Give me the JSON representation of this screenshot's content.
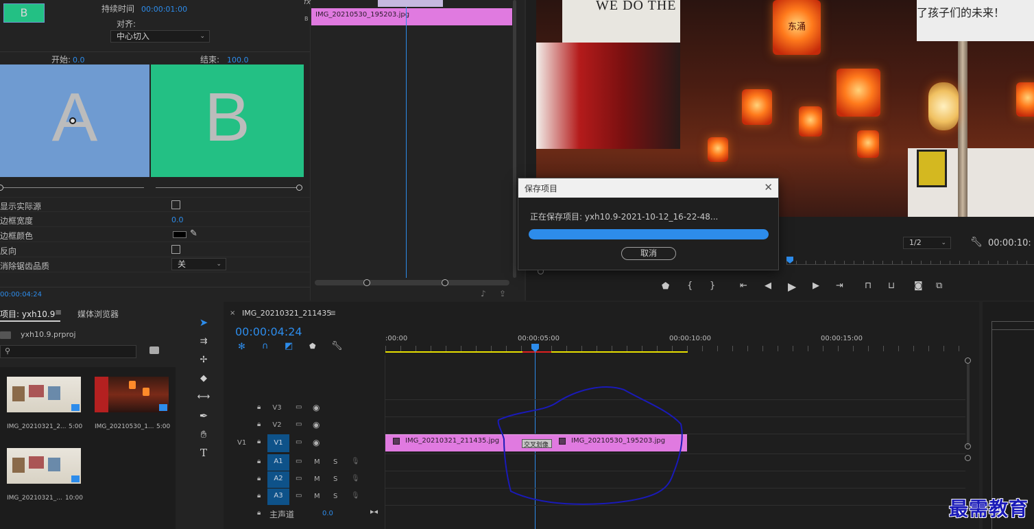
{
  "effect_controls": {
    "duration_label": "持续时间",
    "duration_value": "00:00:01:00",
    "align_label": "对齐:",
    "align_value": "中心切入",
    "start_label": "开始:",
    "start_value": "0.0",
    "end_label": "结束:",
    "end_value": "100.0",
    "preview_a": "A",
    "preview_b": "B",
    "thumb_b": "B",
    "show_source_label": "显示实际源",
    "border_width_label": "边框宽度",
    "border_width_value": "0.0",
    "border_color_label": "边框颜色",
    "reverse_label": "反向",
    "antialias_label": "消除锯齿品质",
    "antialias_value": "关",
    "timecode": "00:00:04:24",
    "fx_symbol": "fx",
    "track_b": "B"
  },
  "mini_timeline": {
    "clip_label": "IMG_20210530_195203.jpg"
  },
  "program_monitor": {
    "sign_text": "WE DO THE",
    "banner_text": "了孩子们的未来！",
    "lantern_text": "东涌",
    "resolution": "1/2",
    "timecode": "00:00:10:"
  },
  "dialog": {
    "title": "保存项目",
    "message": "正在保存项目: yxh10.9-2021-10-12_16-22-48...",
    "progress_percent": 100,
    "cancel_label": "取消"
  },
  "project": {
    "tab_project": "项目: yxh10.9",
    "tab_media": "媒体浏览器",
    "file_name": "yxh10.9.prproj",
    "items": [
      {
        "name": "IMG_20210321_2...",
        "duration": "5:00"
      },
      {
        "name": "IMG_20210530_1...",
        "duration": "5:00"
      },
      {
        "name": "IMG_20210321_...",
        "duration": "10:00"
      }
    ]
  },
  "timeline": {
    "sequence_name": "IMG_20210321_211435",
    "timecode": "00:00:04:24",
    "ruler": [
      ":00:00",
      "00:00:05:00",
      "00:00:10:00",
      "00:00:15:00"
    ],
    "tracks": {
      "v3": "V3",
      "v2": "V2",
      "v1_src": "V1",
      "v1": "V1",
      "a1": "A1",
      "a2": "A2",
      "a3": "A3",
      "mute": "M",
      "solo": "S"
    },
    "master_label": "主声道",
    "master_value": "0.0",
    "clip1": "IMG_20210321_211435.jpg",
    "clip2": "IMG_20210530_195203.jpg",
    "transition": "交叉划像"
  },
  "watermark": "最需教育",
  "colors": {
    "accent": "#2d8ceb",
    "clip": "#e07ae0",
    "track_on": "#0e5289",
    "preview_a": "#6f9bd1",
    "preview_b": "#23c084",
    "annotation": "#1a1ab8"
  }
}
